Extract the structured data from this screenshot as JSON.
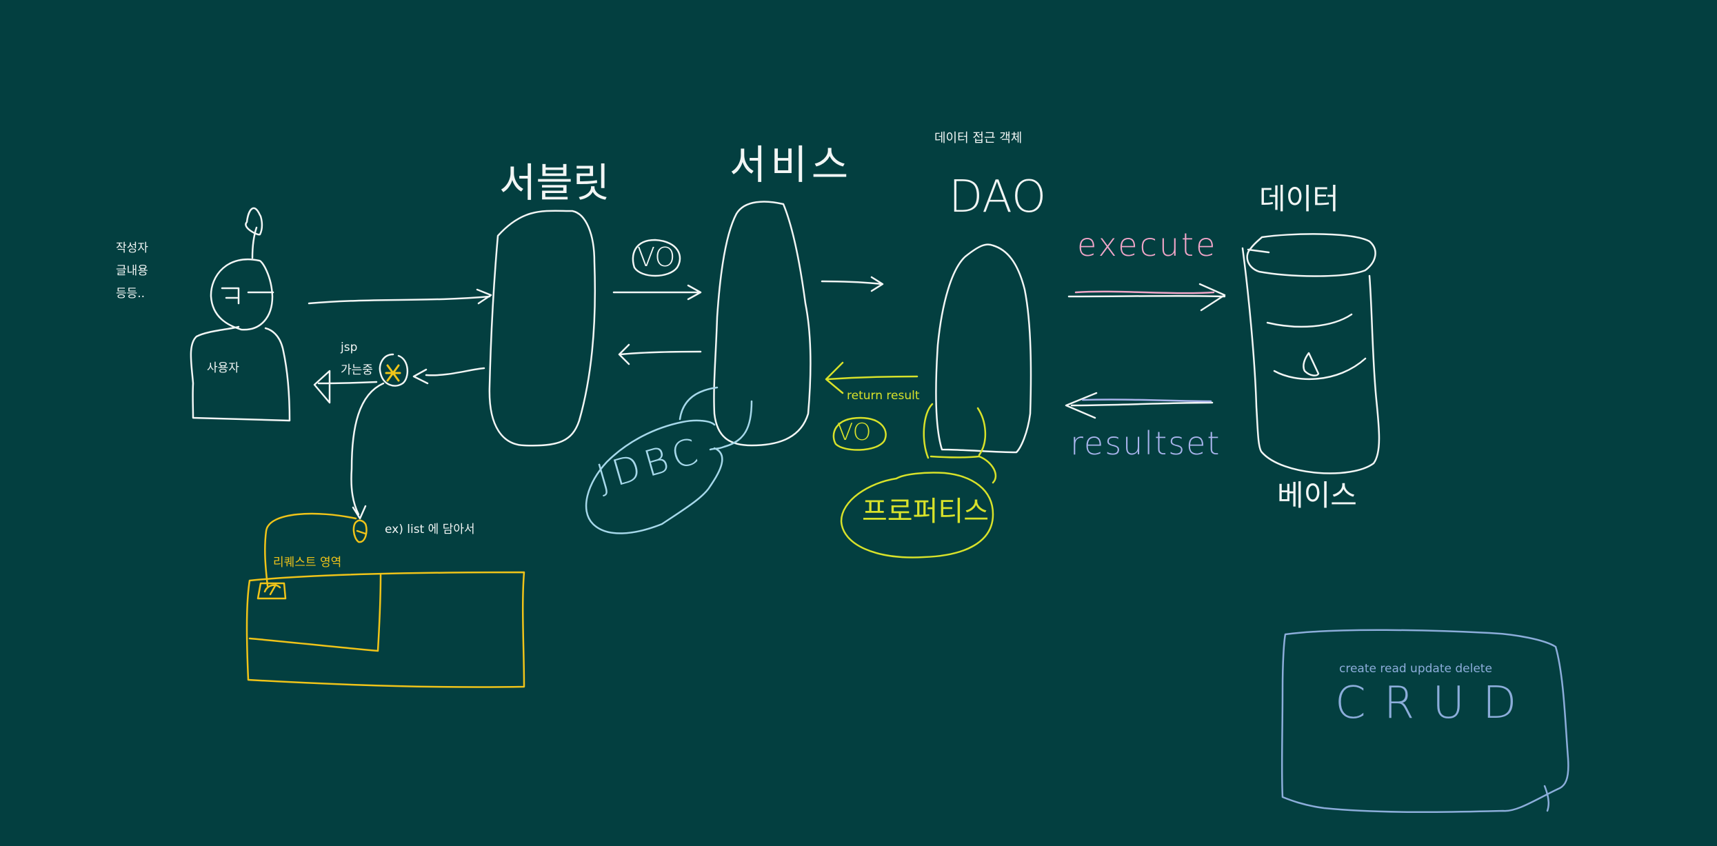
{
  "colors": {
    "background": "#033f40",
    "white": "#f2f6f5",
    "yellow_gold": "#f0c419",
    "lime": "#d8e22a",
    "light_blue": "#a6d8ea",
    "pink": "#f2a6c9",
    "periwinkle": "#a9b4ec",
    "steel_blue": "#8cadda"
  },
  "user": {
    "label": "사용자",
    "notes": [
      "작성자",
      "글내용",
      "등등.."
    ]
  },
  "servlet": {
    "label": "서블릿"
  },
  "service": {
    "label": "서비스"
  },
  "dao": {
    "label": "DAO",
    "caption": "데이터 접근 객체"
  },
  "database": {
    "label_top": "데이터",
    "label_bottom": "베이스"
  },
  "flow": {
    "vo_top": "VO",
    "jsp": [
      "jsp",
      "가는중"
    ],
    "return_result": "return result",
    "vo_bottom": "VO",
    "properties": "프로퍼티스",
    "jdbc": "JDBC",
    "execute": "execute",
    "resultset": "resultset",
    "list_note": "ex) list 에 담아서",
    "request_area": "리퀘스트 영역"
  },
  "crud_note": {
    "caption": "create read update delete",
    "title": "CRUD"
  }
}
